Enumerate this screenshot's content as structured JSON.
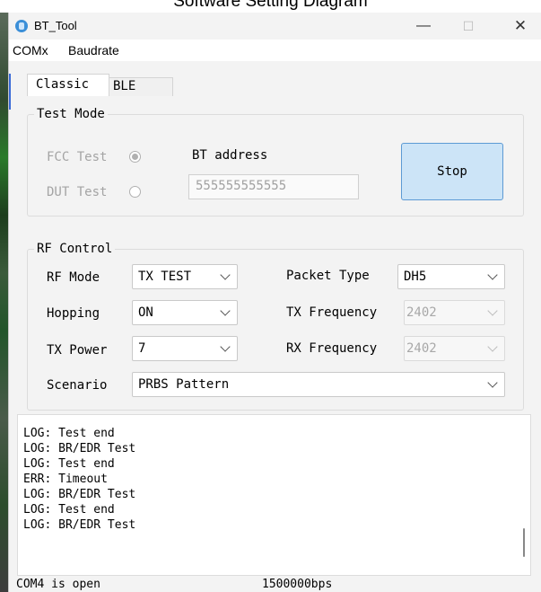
{
  "caption": "Software Setting Diagram",
  "window": {
    "title": "BT_Tool"
  },
  "titlebar_buttons": {
    "minimize": "—",
    "maximize": "☐",
    "close": "✕"
  },
  "menu": [
    "COMx",
    "Baudrate"
  ],
  "tabs": [
    {
      "label": "Classic",
      "active": true
    },
    {
      "label": "BLE",
      "active": false
    }
  ],
  "test_mode": {
    "legend": "Test Mode",
    "fcc_label": "FCC Test",
    "dut_label": "DUT Test",
    "selected": "FCC Test",
    "bt_address_label": "BT address",
    "bt_address_value": "555555555555",
    "stop_label": "Stop"
  },
  "rf_control": {
    "legend": "RF Control",
    "rf_mode_label": "RF Mode",
    "rf_mode_value": "TX TEST",
    "hopping_label": "Hopping",
    "hopping_value": "ON",
    "tx_power_label": "TX Power",
    "tx_power_value": "7",
    "scenario_label": "Scenario",
    "scenario_value": "PRBS Pattern",
    "packet_type_label": "Packet Type",
    "packet_type_value": "DH5",
    "tx_freq_label": "TX Frequency",
    "tx_freq_value": "2402",
    "rx_freq_label": "RX Frequency",
    "rx_freq_value": "2402"
  },
  "log_lines": [
    "LOG: Test end",
    "LOG: BR/EDR Test",
    "LOG: Test end",
    "ERR: Timeout",
    "LOG: BR/EDR Test",
    "LOG: Test end",
    "LOG: BR/EDR Test"
  ],
  "status": {
    "port": "COM4 is open",
    "baud": "1500000bps"
  },
  "colors": {
    "accent": "#5c9ad4",
    "button_bg": "#cce4f7",
    "window_bg": "#f3f3f3"
  }
}
